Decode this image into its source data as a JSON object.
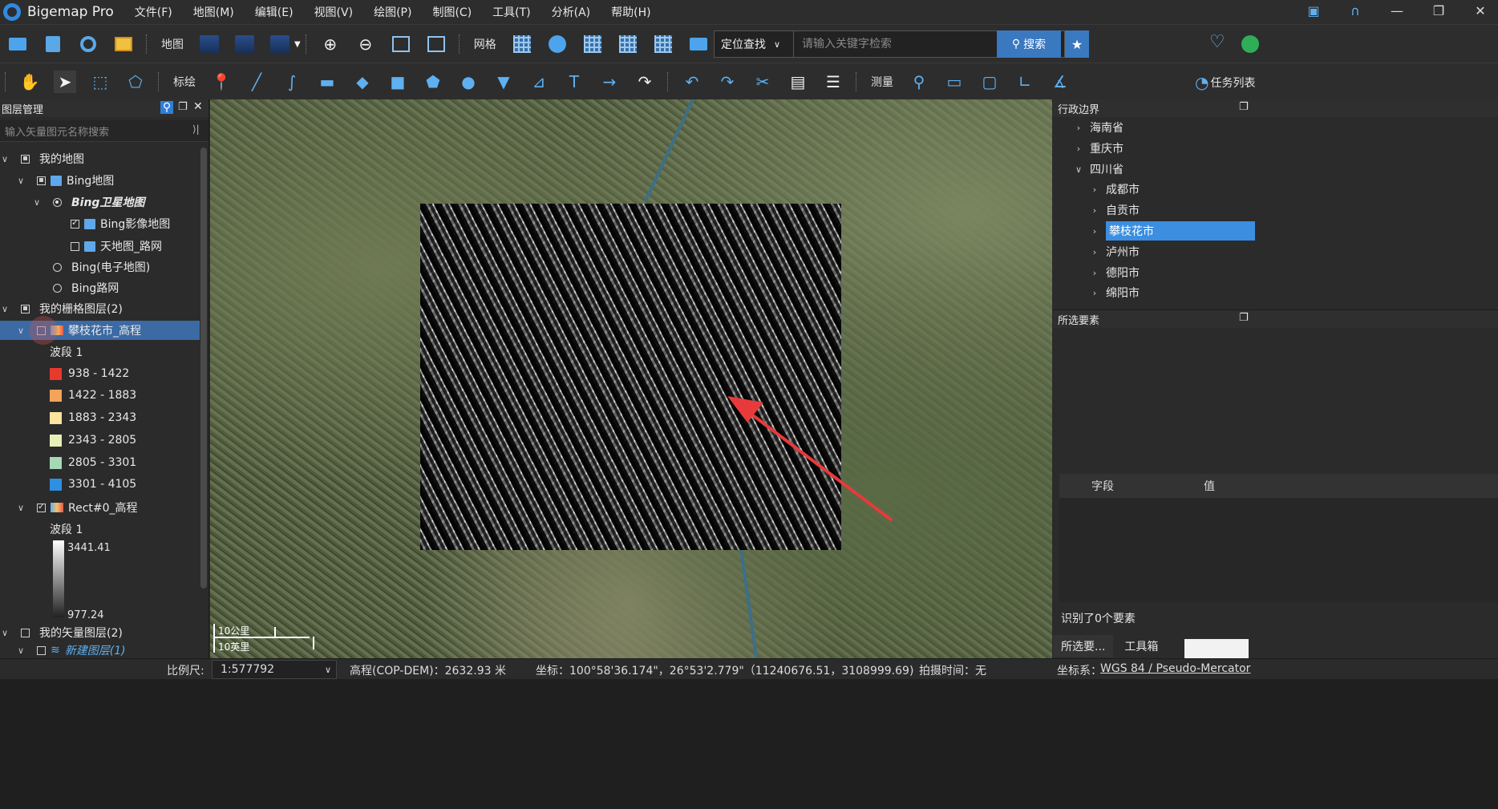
{
  "app": {
    "name": "Bigemap Pro"
  },
  "menu": [
    "文件(F)",
    "地图(M)",
    "编辑(E)",
    "视图(V)",
    "绘图(P)",
    "制图(C)",
    "工具(T)",
    "分析(A)",
    "帮助(H)"
  ],
  "toolbar1": {
    "map_label": "地图",
    "grid_label": "网格",
    "search_type": "定位查找",
    "search_placeholder": "请输入关键字检索",
    "search_button": "搜索"
  },
  "toolbar2": {
    "annotate_label": "标绘",
    "measure_label": "测量",
    "tasks_label": "任务列表"
  },
  "layer_panel": {
    "title": "图层管理",
    "search_placeholder": "输入矢量图元名称搜索",
    "tree": {
      "my_map": "我的地图",
      "bing_map": "Bing地图",
      "bing_satellite": "Bing卫星地图",
      "bing_imagery": "Bing影像地图",
      "tianditu_road": "天地图_路网",
      "bing_electronic": "Bing(电子地图)",
      "bing_road": "Bing路网",
      "raster_layers": "我的栅格图层(2)",
      "panzhihua_dem": "攀枝花市_高程",
      "band1": "波段 1",
      "legend": [
        {
          "label": "938 - 1422",
          "color": "#e8392c"
        },
        {
          "label": "1422 - 1883",
          "color": "#f5a25a"
        },
        {
          "label": "1883 - 2343",
          "color": "#fbe3a0"
        },
        {
          "label": "2343 - 2805",
          "color": "#e6f0b8"
        },
        {
          "label": "2805 - 3301",
          "color": "#a6d8b4"
        },
        {
          "label": "3301 - 4105",
          "color": "#2f8fe0"
        }
      ],
      "rect_dem": "Rect#0_高程",
      "band1_b": "波段 1",
      "gray_max": "3441.41",
      "gray_min": "977.24",
      "vector_layers": "我的矢量图层(2)",
      "new_layer": "新建图层(1)"
    }
  },
  "map": {
    "scale_km": "10公里",
    "scale_mi": "10英里"
  },
  "admin_panel": {
    "title": "行政边界",
    "items": [
      {
        "label": "海南省",
        "level": 1,
        "expanded": false
      },
      {
        "label": "重庆市",
        "level": 1,
        "expanded": false
      },
      {
        "label": "四川省",
        "level": 1,
        "expanded": true
      },
      {
        "label": "成都市",
        "level": 2,
        "expanded": false
      },
      {
        "label": "自贡市",
        "level": 2,
        "expanded": false
      },
      {
        "label": "攀枝花市",
        "level": 2,
        "expanded": false,
        "selected": true
      },
      {
        "label": "泸州市",
        "level": 2,
        "expanded": false
      },
      {
        "label": "德阳市",
        "level": 2,
        "expanded": false
      },
      {
        "label": "绵阳市",
        "level": 2,
        "expanded": false
      }
    ]
  },
  "selected_panel": {
    "title": "所选要素",
    "col_field": "字段",
    "col_value": "值",
    "status": "识别了0个要素",
    "tab_selected": "所选要...",
    "tab_toolbox": "工具箱"
  },
  "statusbar": {
    "scale_label": "比例尺:",
    "scale_value": "1:577792",
    "elevation": "高程(COP-DEM)：2632.93 米",
    "coords": "坐标：100°58'36.174\"，26°53'2.779\"（11240676.51，3108999.69)",
    "capture_time": "拍摄时间：无",
    "crs_label": "坐标系：",
    "crs_value": "WGS 84 / Pseudo-Mercator"
  }
}
